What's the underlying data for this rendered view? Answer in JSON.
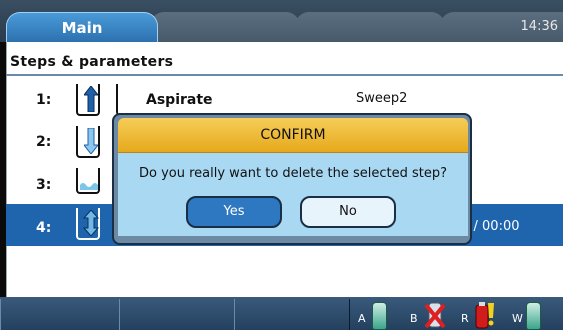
{
  "header": {
    "tab_main": "Main",
    "clock": "14:36"
  },
  "section": {
    "heading": "Steps & parameters"
  },
  "steps": [
    {
      "number": "1:",
      "name": "Aspirate",
      "param": "Sweep2"
    },
    {
      "number": "2:"
    },
    {
      "number": "3:"
    },
    {
      "number": "4:",
      "param": ": / 00:00",
      "selected": true
    }
  ],
  "dialog": {
    "title": "CONFIRM",
    "message": "Do you really want to delete the selected step?",
    "yes_label": "Yes",
    "no_label": "No"
  },
  "reservoirs": [
    {
      "label": "A",
      "icon": "teal-bottle-icon"
    },
    {
      "label": "B",
      "icon": "empty-bottle-x-icon"
    },
    {
      "label": "R",
      "icon": "red-bottle-warning-icon"
    },
    {
      "label": "W",
      "icon": "teal-bottle-icon"
    }
  ],
  "colors": {
    "accent": "#1f65ae",
    "dialog_title": "#f0c040",
    "dialog_body": "#a9d8f3"
  }
}
